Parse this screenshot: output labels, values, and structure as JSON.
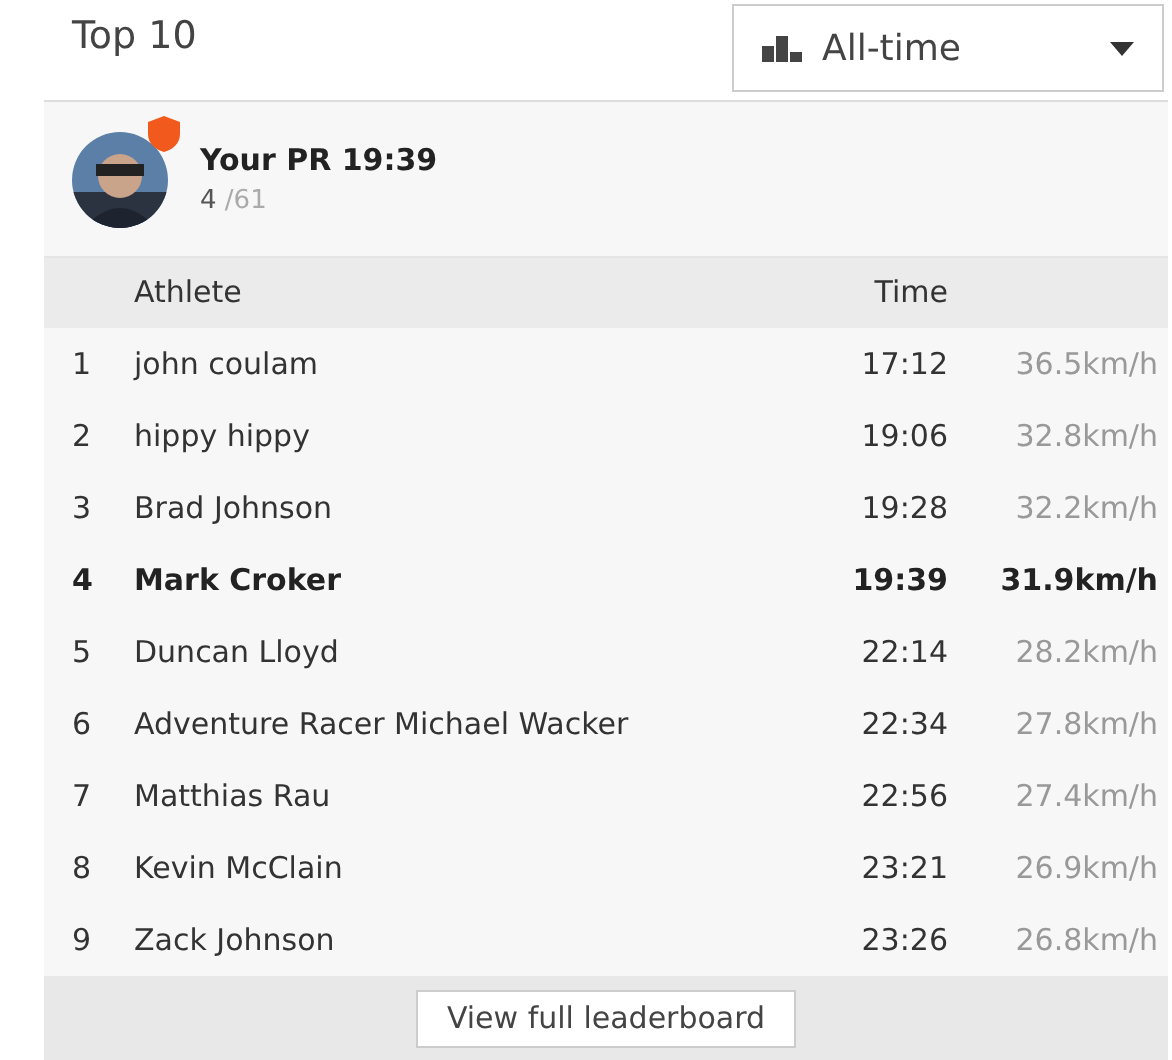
{
  "title": "Top 10",
  "filter": {
    "label": "All-time"
  },
  "your_pr": {
    "label": "Your PR 19:39",
    "rank": "4",
    "total": "/61"
  },
  "table": {
    "columns": [
      "Athlete",
      "Time"
    ],
    "rows": [
      {
        "rank": "1",
        "athlete": "john coulam",
        "time": "17:12",
        "speed": "36.5km/h",
        "highlighted": false
      },
      {
        "rank": "2",
        "athlete": "hippy hippy",
        "time": "19:06",
        "speed": "32.8km/h",
        "highlighted": false
      },
      {
        "rank": "3",
        "athlete": "Brad Johnson",
        "time": "19:28",
        "speed": "32.2km/h",
        "highlighted": false
      },
      {
        "rank": "4",
        "athlete": "Mark Croker",
        "time": "19:39",
        "speed": "31.9km/h",
        "highlighted": true
      },
      {
        "rank": "5",
        "athlete": "Duncan Lloyd",
        "time": "22:14",
        "speed": "28.2km/h",
        "highlighted": false
      },
      {
        "rank": "6",
        "athlete": "Adventure Racer Michael Wacker",
        "time": "22:34",
        "speed": "27.8km/h",
        "highlighted": false
      },
      {
        "rank": "7",
        "athlete": "Matthias Rau",
        "time": "22:56",
        "speed": "27.4km/h",
        "highlighted": false
      },
      {
        "rank": "8",
        "athlete": "Kevin McClain",
        "time": "23:21",
        "speed": "26.9km/h",
        "highlighted": false
      },
      {
        "rank": "9",
        "athlete": "Zack Johnson",
        "time": "23:26",
        "speed": "26.8km/h",
        "highlighted": false
      }
    ]
  },
  "footer_button": "View full leaderboard"
}
